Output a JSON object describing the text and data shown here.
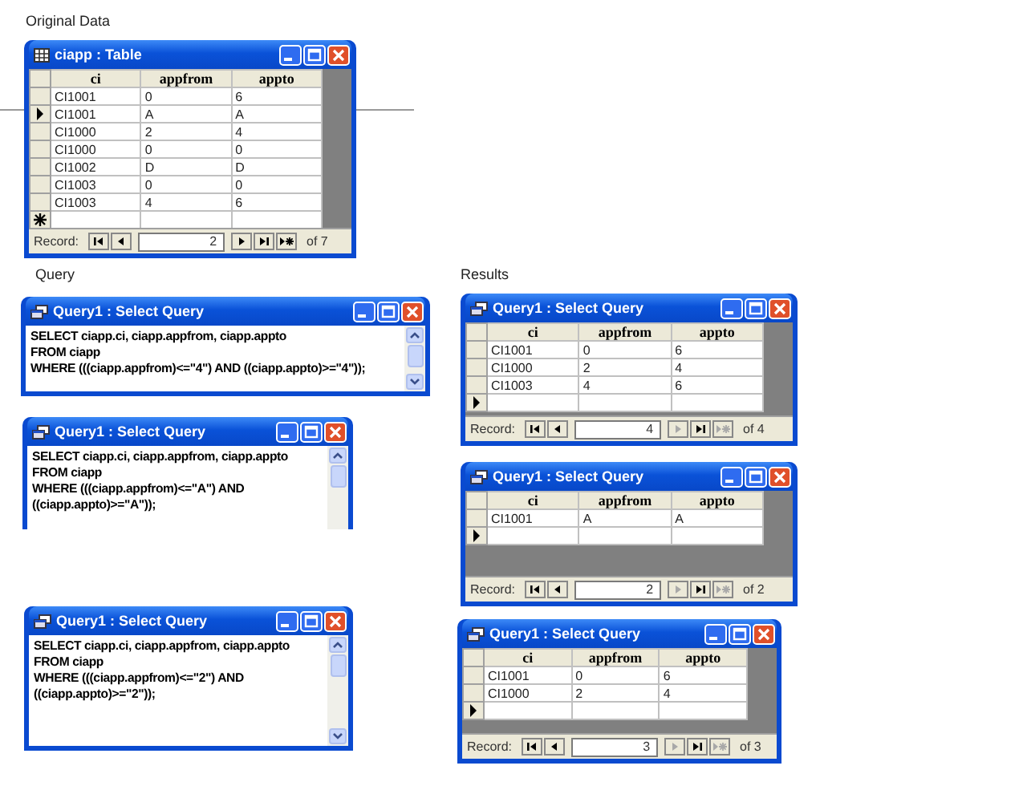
{
  "labels": {
    "original_data": "Original Data",
    "query": "Query",
    "results": "Results"
  },
  "windows": [
    {
      "kind": "table",
      "title": "ciapp : Table",
      "columns": [
        "ci",
        "appfrom",
        "appto"
      ],
      "rows": [
        {
          "cells": [
            "CI1001",
            "0",
            "6"
          ],
          "current": false
        },
        {
          "cells": [
            "CI1001",
            "A",
            "A"
          ],
          "current": true
        },
        {
          "cells": [
            "CI1000",
            "2",
            "4"
          ],
          "current": false
        },
        {
          "cells": [
            "CI1000",
            "0",
            "0"
          ],
          "current": false
        },
        {
          "cells": [
            "CI1002",
            "D",
            "D"
          ],
          "current": false
        },
        {
          "cells": [
            "CI1003",
            "0",
            "0"
          ],
          "current": false
        },
        {
          "cells": [
            "CI1003",
            "4",
            "6"
          ],
          "current": false
        }
      ],
      "new_row": {
        "current": false
      },
      "nav": {
        "label": "Record:",
        "record": "2",
        "count": "of 7",
        "at_end": false
      }
    },
    {
      "kind": "query_sql",
      "title": "Query1 : Select Query",
      "lines": [
        "SELECT ciapp.ci, ciapp.appfrom, ciapp.appto",
        "FROM ciapp",
        "WHERE (((ciapp.appfrom)<=\"4\") AND ((ciapp.appto)>=\"4\"));"
      ]
    },
    {
      "kind": "query_sql",
      "title": "Query1 : Select Query",
      "lines": [
        "SELECT ciapp.ci, ciapp.appfrom, ciapp.appto",
        "FROM ciapp",
        "WHERE (((ciapp.appfrom)<=\"A\") AND",
        "((ciapp.appto)>=\"A\"));"
      ]
    },
    {
      "kind": "query_sql",
      "title": "Query1 : Select Query",
      "lines": [
        "SELECT ciapp.ci, ciapp.appfrom, ciapp.appto",
        "FROM ciapp",
        "WHERE (((ciapp.appfrom)<=\"2\") AND",
        "((ciapp.appto)>=\"2\"));"
      ]
    },
    {
      "kind": "query_datasheet",
      "title": "Query1 : Select Query",
      "columns": [
        "ci",
        "appfrom",
        "appto"
      ],
      "rows": [
        {
          "cells": [
            "CI1001",
            "0",
            "6"
          ],
          "current": false
        },
        {
          "cells": [
            "CI1000",
            "2",
            "4"
          ],
          "current": false
        },
        {
          "cells": [
            "CI1003",
            "4",
            "6"
          ],
          "current": false
        }
      ],
      "new_row": {
        "current": true
      },
      "nav": {
        "label": "Record:",
        "record": "4",
        "count": "of 4",
        "at_end": true
      }
    },
    {
      "kind": "query_datasheet",
      "title": "Query1 : Select Query",
      "columns": [
        "ci",
        "appfrom",
        "appto"
      ],
      "rows": [
        {
          "cells": [
            "CI1001",
            "A",
            "A"
          ],
          "current": false
        }
      ],
      "new_row": {
        "current": true
      },
      "nav": {
        "label": "Record:",
        "record": "2",
        "count": "of 2",
        "at_end": true
      }
    },
    {
      "kind": "query_datasheet",
      "title": "Query1 : Select Query",
      "columns": [
        "ci",
        "appfrom",
        "appto"
      ],
      "rows": [
        {
          "cells": [
            "CI1001",
            "0",
            "6"
          ],
          "current": false
        },
        {
          "cells": [
            "CI1000",
            "2",
            "4"
          ],
          "current": false
        }
      ],
      "new_row": {
        "current": true
      },
      "nav": {
        "label": "Record:",
        "record": "3",
        "count": "of 3",
        "at_end": true
      }
    }
  ]
}
